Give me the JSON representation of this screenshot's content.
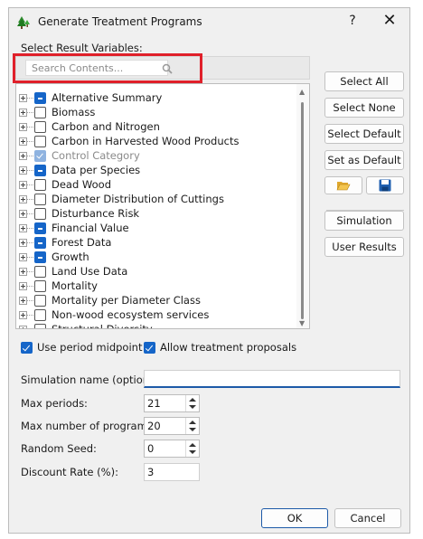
{
  "window": {
    "title": "Generate Treatment Programs",
    "help_symbol": "?",
    "close_symbol": "✕",
    "app_icon": "tree-icon"
  },
  "result_variables": {
    "label": "Select Result Variables:",
    "search_placeholder": "Search Contents...",
    "items": [
      {
        "label": "Alternative Summary",
        "state": "partial",
        "disabled": false
      },
      {
        "label": "Biomass",
        "state": "unchecked",
        "disabled": false
      },
      {
        "label": "Carbon and Nitrogen",
        "state": "unchecked",
        "disabled": false
      },
      {
        "label": "Carbon in Harvested Wood Products",
        "state": "unchecked",
        "disabled": false
      },
      {
        "label": "Control Category",
        "state": "checked",
        "disabled": true
      },
      {
        "label": "Data per Species",
        "state": "partial",
        "disabled": false
      },
      {
        "label": "Dead Wood",
        "state": "unchecked",
        "disabled": false
      },
      {
        "label": "Diameter Distribution of Cuttings",
        "state": "unchecked",
        "disabled": false
      },
      {
        "label": "Disturbance Risk",
        "state": "unchecked",
        "disabled": false
      },
      {
        "label": "Financial Value",
        "state": "partial",
        "disabled": false
      },
      {
        "label": "Forest Data",
        "state": "partial",
        "disabled": false
      },
      {
        "label": "Growth",
        "state": "partial",
        "disabled": false
      },
      {
        "label": "Land Use Data",
        "state": "unchecked",
        "disabled": false
      },
      {
        "label": "Mortality",
        "state": "unchecked",
        "disabled": false
      },
      {
        "label": "Mortality per Diameter Class",
        "state": "unchecked",
        "disabled": false
      },
      {
        "label": "Non-wood ecosystem services",
        "state": "unchecked",
        "disabled": false
      },
      {
        "label": "Structural Diversity",
        "state": "unchecked",
        "disabled": false
      }
    ]
  },
  "side_buttons": {
    "select_all": "Select All",
    "select_none": "Select None",
    "select_default": "Select Default",
    "set_as_default": "Set as Default",
    "open_icon": "folder-open-icon",
    "save_icon": "save-icon",
    "simulation": "Simulation",
    "user_results": "User Results"
  },
  "options": {
    "use_period_midpoint": {
      "label": "Use period midpoint",
      "checked": true
    },
    "allow_treatment_proposals": {
      "label": "Allow treatment proposals",
      "checked": true
    }
  },
  "form": {
    "simulation_name_label": "Simulation name (optional):",
    "simulation_name_value": "",
    "max_periods_label": "Max periods:",
    "max_periods_value": "21",
    "max_programs_label": "Max number of programs:",
    "max_programs_value": "20",
    "random_seed_label": "Random Seed:",
    "random_seed_value": "0",
    "discount_rate_label": "Discount Rate (%):",
    "discount_rate_value": "3"
  },
  "footer": {
    "ok": "OK",
    "cancel": "Cancel"
  },
  "colors": {
    "accent": "#1565c8",
    "highlight_box": "#e0202a"
  }
}
